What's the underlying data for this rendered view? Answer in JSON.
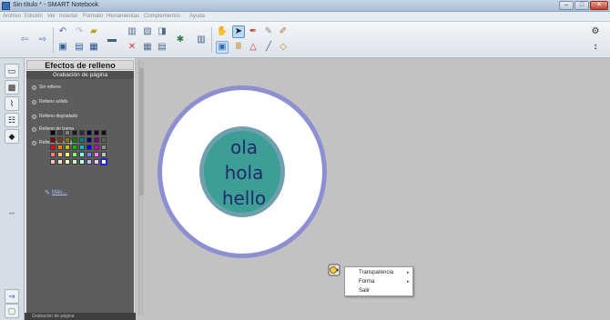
{
  "window": {
    "title": "Sin título * - SMART Notebook",
    "controls": {
      "minimize": "–",
      "maximize": "□",
      "close": "✕"
    }
  },
  "menu": {
    "items": [
      "Archivo",
      "Edición",
      "Ver",
      "Insertar",
      "Formato",
      "Herramientas",
      "Complementos",
      "Ayuda"
    ]
  },
  "toolbar": {
    "icons": [
      "back-arrow-icon",
      "forward-arrow-icon",
      "undo-icon",
      "redo-icon",
      "open-folder-icon",
      "save-icon",
      "add-page-icon",
      "delete-icon",
      "screen-shade-icon",
      "table-icon",
      "document-camera-icon",
      "screen-capture-icon",
      "measurement-tools-icon",
      "select-icon",
      "pen-icon",
      "eraser-icon",
      "highlighter-icon",
      "magic-pen-icon",
      "shapes-icon",
      "line-icon",
      "fill-icon",
      "properties-icon",
      "settings-icon",
      "move-toolbar-icon"
    ]
  },
  "side_tabs": [
    "page-sorter-icon",
    "gallery-icon",
    "attachments-icon",
    "properties-icon",
    "addons-icon"
  ],
  "panel": {
    "title": "Efectos de relleno",
    "subtitle": "Grabación de página",
    "options": [
      {
        "label": "Sin relleno",
        "selected": false
      },
      {
        "label": "Relleno sólido",
        "selected": true
      },
      {
        "label": "Relleno degradado",
        "selected": false
      },
      {
        "label": "Relleno de trama",
        "selected": false
      },
      {
        "label": "Relleno de imagen",
        "selected": false
      }
    ],
    "more_colors": "Más...",
    "footer": "Grabación de página"
  },
  "palette": [
    "#000000",
    "#404040",
    "#808080",
    "#1a1a1a",
    "#303030",
    "#000033",
    "#220022",
    "#111111",
    "#7f0000",
    "#804000",
    "#808000",
    "#008000",
    "#008080",
    "#000080",
    "#800080",
    "#606060",
    "#ff0000",
    "#ff8000",
    "#c0c000",
    "#00c000",
    "#00c0c0",
    "#0000ff",
    "#c000c0",
    "#909090",
    "#ff8080",
    "#ffc080",
    "#ffff80",
    "#80ff80",
    "#80ffff",
    "#8080ff",
    "#ff80ff",
    "#c0c0c0",
    "#ffc0c0",
    "#ffe0c0",
    "#ffffc0",
    "#c0ffc0",
    "#c0ffff",
    "#c0c0ff",
    "#ffc0ff",
    "#ffffff"
  ],
  "canvas": {
    "words": [
      "ola",
      "hola",
      "hello"
    ],
    "colors": {
      "outer_fill": "#ffffff",
      "outer_border": "#8c8fd1",
      "inner_fill": "#3d9e96",
      "inner_border": "#6ea1ad",
      "text": "#202a6a"
    }
  },
  "context_menu": {
    "items": [
      {
        "label": "Transparencia",
        "submenu": true
      },
      {
        "label": "Forma",
        "submenu": true
      },
      {
        "label": "Salir",
        "submenu": false
      }
    ],
    "arrow": "▸"
  }
}
